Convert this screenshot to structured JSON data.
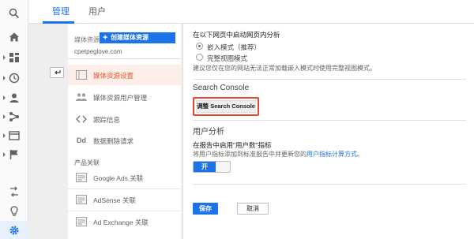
{
  "tabs": {
    "admin": "管理",
    "user": "用户"
  },
  "nav": {
    "resource_label": "媒体资源",
    "create_button": "创建媒体资源",
    "domain": "cpetpeglove.com",
    "items": [
      {
        "label": "媒体资源设置",
        "icon": "property-settings-icon",
        "active": true
      },
      {
        "label": "媒体资源用户管理",
        "icon": "users-icon",
        "active": false
      },
      {
        "label": "跟踪信息",
        "icon": "code-icon",
        "active": false
      },
      {
        "label": "数据删除请求",
        "icon": "dd-icon",
        "active": false
      }
    ],
    "section_label": "产品关联",
    "links": [
      {
        "label": "Google Ads 关联",
        "icon": "google-ads-icon"
      },
      {
        "label": "AdSense 关联",
        "icon": "adsense-icon"
      },
      {
        "label": "Ad Exchange 关联",
        "icon": "ad-exchange-icon"
      }
    ]
  },
  "content": {
    "inpage_heading": "在以下网页中启动网页内分析",
    "radio_embedded": "嵌入模式（推荐）",
    "radio_fullview": "完整视图模式",
    "inpage_hint": "建议您仅在您的网站无法正常加载嵌入模式时使用完整视图模式。",
    "search_console_title": "Search Console",
    "adjust_sc_button": "调整 Search Console",
    "user_analysis_title": "用户分析",
    "enable_users_label": "在报告中启用\"用户数\"指标",
    "users_hint_prefix": "将用户指标添加到标准报告中并更新您的",
    "users_hint_link": "用户指标计算方式",
    "users_hint_suffix": "。",
    "toggle_on": "开",
    "save": "保存",
    "cancel": "取消"
  },
  "colors": {
    "accent": "#1a73e8",
    "active_nav": "#e8552e",
    "highlight": "#e8452c"
  }
}
